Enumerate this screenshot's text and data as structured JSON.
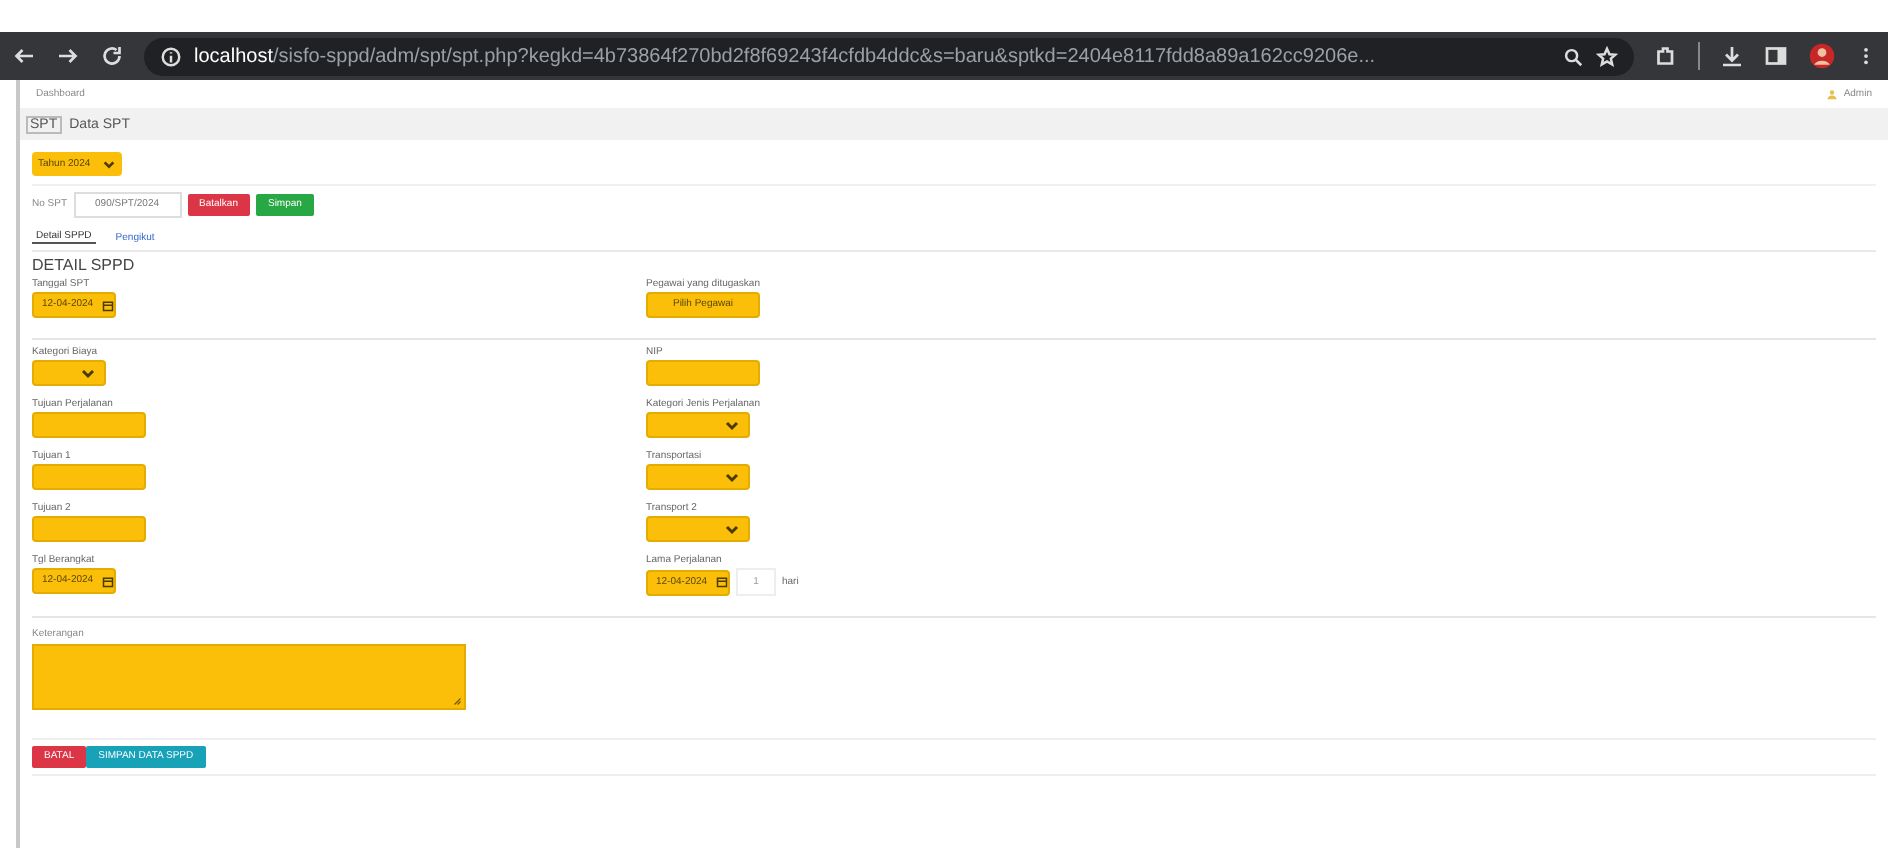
{
  "browser": {
    "url_host": "localhost",
    "url_path": "/sisfo-sppd/adm/spt/spt.php?kegkd=4b73864f270bd2f8f69243f4cfdb4ddc&s=baru&sptkd=2404e8117fdd8a89a162cc9206e..."
  },
  "breadcrumb": "Dashboard",
  "user": "Admin",
  "page_title": {
    "code": "SPT",
    "text": "Data SPT"
  },
  "year_select": "Tahun 2024",
  "spt_no": {
    "label": "No SPT",
    "value": "090/SPT/2024"
  },
  "action_buttons": [
    {
      "label": "Batalkan",
      "kind": "danger"
    },
    {
      "label": "Simpan",
      "kind": "success"
    }
  ],
  "tabs": [
    {
      "label": "Detail SPPD",
      "selected": true
    },
    {
      "label": "Pengikut",
      "selected": false
    }
  ],
  "heading": "DETAIL SPPD",
  "rows": [
    {
      "left": {
        "label": "Tanggal SPT",
        "kind": "date",
        "value": "12-04-2024"
      },
      "right": {
        "label": "Pegawai yang ditugaskan",
        "kind": "button",
        "value": "Pilih Pegawai"
      },
      "divider": true
    },
    {
      "left": {
        "label": "Kategori Biaya",
        "kind": "select"
      },
      "right": {
        "label": "NIP",
        "kind": "input"
      },
      "divider": false
    },
    {
      "left": {
        "label": "Tujuan Perjalanan",
        "kind": "input"
      },
      "right": {
        "label": "Kategori Jenis Perjalanan",
        "kind": "select"
      },
      "divider": false
    },
    {
      "left": {
        "label": "Tujuan 1",
        "kind": "input"
      },
      "right": {
        "label": "Transportasi",
        "kind": "select"
      },
      "divider": false
    },
    {
      "left": {
        "label": "Tujuan 2",
        "kind": "input"
      },
      "right": {
        "label": "Transport 2",
        "kind": "select"
      },
      "divider": false
    },
    {
      "left": {
        "label": "Tgl Berangkat",
        "kind": "date",
        "value": "12-04-2024"
      },
      "right": {
        "label": "Lama Perjalanan",
        "kind": "duration",
        "value": "12-04-2024",
        "count": "1",
        "unit": "hari"
      },
      "divider": true
    }
  ],
  "notes": {
    "label": "Keterangan"
  },
  "bottom_buttons": [
    {
      "label": "BATAL",
      "kind": "danger"
    },
    {
      "label": "SIMPAN DATA SPPD",
      "kind": "info"
    }
  ]
}
